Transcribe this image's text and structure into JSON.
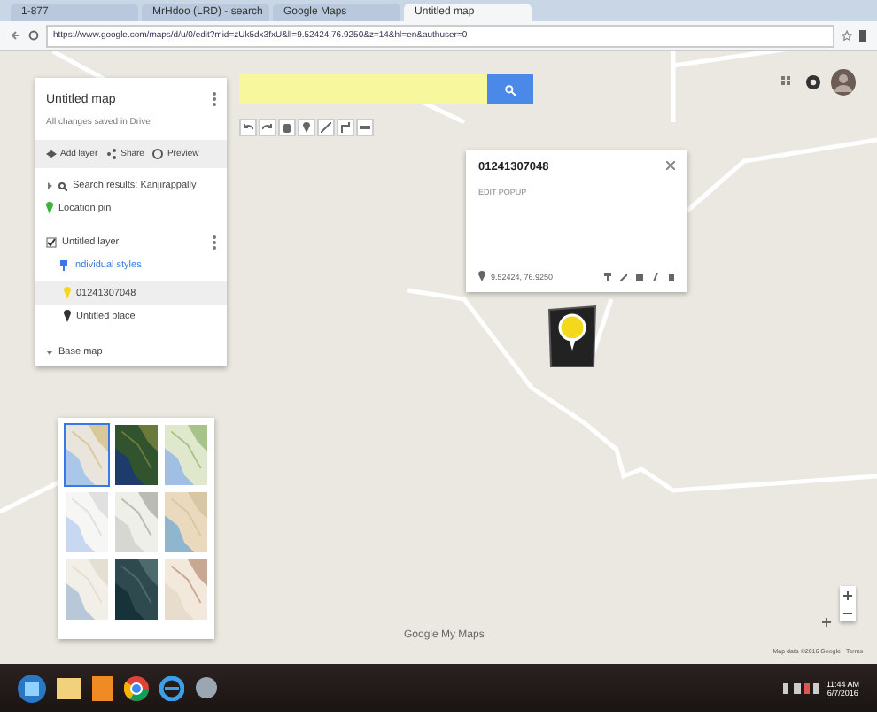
{
  "browser": {
    "tabs": [
      {
        "label": "1-877",
        "selected": false
      },
      {
        "label": "MrHdoo (LRD) - search",
        "selected": false
      },
      {
        "label": "Google Maps",
        "selected": false
      },
      {
        "label": "Untitled map",
        "selected": true
      }
    ],
    "address": "https://www.google.com/maps/d/u/0/edit?mid=zUk5dx3fxU&ll=9.52424,76.9250&z=14&hl=en&authuser=0"
  },
  "panel": {
    "title": "Untitled map",
    "subtitle": "All changes saved in Drive",
    "actions": [
      {
        "label": "Add layer",
        "kind": "layer"
      },
      {
        "label": "Share",
        "kind": "share"
      },
      {
        "label": "Preview",
        "kind": "preview"
      }
    ],
    "search_result": {
      "label": "Search results: Kanjirappally",
      "expanded": false
    },
    "result_item": "Location pin",
    "layer": {
      "title": "Untitled layer",
      "checked": true,
      "style": "Individual styles",
      "items": [
        {
          "label": "01241307048",
          "selected": true,
          "color": "#f4d81c"
        },
        {
          "label": "Untitled place",
          "selected": false,
          "color": "#333333"
        }
      ]
    },
    "base_map": {
      "label": "Base map",
      "expanded": true,
      "styles": [
        {
          "kind": "map",
          "selected": true
        },
        {
          "kind": "satellite",
          "selected": false
        },
        {
          "kind": "terrain",
          "selected": false
        },
        {
          "kind": "light",
          "selected": false
        },
        {
          "kind": "mono",
          "selected": false
        },
        {
          "kind": "atlas",
          "selected": false
        },
        {
          "kind": "political",
          "selected": false
        },
        {
          "kind": "dark",
          "selected": false
        },
        {
          "kind": "vintage",
          "selected": false
        }
      ]
    }
  },
  "popup": {
    "title": "01241307048",
    "description": "EDIT POPUP",
    "location": "9.52424, 76.9250"
  },
  "footer": {
    "logo": "Google My Maps",
    "attribution": "Map data ©2016 Google",
    "terms": "Terms"
  },
  "taskbar": {
    "time": "11:44 AM",
    "date": "6/7/2016"
  }
}
